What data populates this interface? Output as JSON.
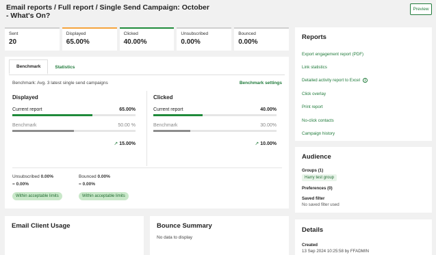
{
  "header": {
    "title": "Email reports / Full report / Single Send Campaign: October - What's On?",
    "preview_label": "Preview"
  },
  "stats": [
    {
      "label": "Sent",
      "value": "20",
      "accent": "#cfcfcf"
    },
    {
      "label": "Displayed",
      "value": "65.00%",
      "accent": "#f5a33b"
    },
    {
      "label": "Clicked",
      "value": "40.00%",
      "accent": "#1f8a3a"
    },
    {
      "label": "Unsubscribed",
      "value": "0.00%",
      "accent": "#cfcfcf"
    },
    {
      "label": "Bounced",
      "value": "0.00%",
      "accent": "#cfcfcf"
    }
  ],
  "benchmark": {
    "tabs": [
      "Benchmark",
      "Statistics"
    ],
    "description": "Benchmark: Avg. 3 latest single send campaigns",
    "settings_label": "Benchmark settings",
    "displayed": {
      "title": "Displayed",
      "current_label": "Current report",
      "current_value": "65.00%",
      "current_fraction": 0.65,
      "bench_label": "Benchmark",
      "bench_value": "50.00 %",
      "bench_fraction": 0.5,
      "diff_arrow": "↗",
      "diff": "15.00%"
    },
    "clicked": {
      "title": "Clicked",
      "current_label": "Current report",
      "current_value": "40.00%",
      "current_fraction": 0.4,
      "bench_label": "Benchmark",
      "bench_value": "30.00%",
      "bench_fraction": 0.3,
      "diff_arrow": "↗",
      "diff": "10.00%"
    },
    "unsubscribed": {
      "label": "Unsubscribed",
      "value": "0.00%",
      "eq": "=",
      "bench": "0.00%",
      "pill": "Within acceptable limits"
    },
    "bounced": {
      "label": "Bounced",
      "value": "0.00%",
      "eq": "=",
      "bench": "0.00%",
      "pill": "Within acceptable limits"
    }
  },
  "email_client": {
    "title": "Email Client Usage"
  },
  "bounce_summary": {
    "title": "Bounce Summary",
    "empty": "No data to display"
  },
  "reports": {
    "title": "Reports",
    "links": [
      "Export engagement report (PDF)",
      "Link statistics",
      "Detailed activity report to Excel",
      "Click overlay",
      "Print report",
      "No-click contacts",
      "Campaign history"
    ]
  },
  "audience": {
    "title": "Audience",
    "groups_label": "Groups (1)",
    "group_tag": "Harry test group",
    "preferences_label": "Preferences (0)",
    "saved_filter_label": "Saved filter",
    "saved_filter_value": "No saved filter used"
  },
  "details": {
    "title": "Details",
    "created_label": "Created",
    "created_value": "13 Sep 2024 10:25:58 by FFADMIN"
  },
  "colors": {
    "green": "#1f8a3a",
    "grey_bar": "#8c8c8c",
    "orange": "#f5a33b"
  }
}
